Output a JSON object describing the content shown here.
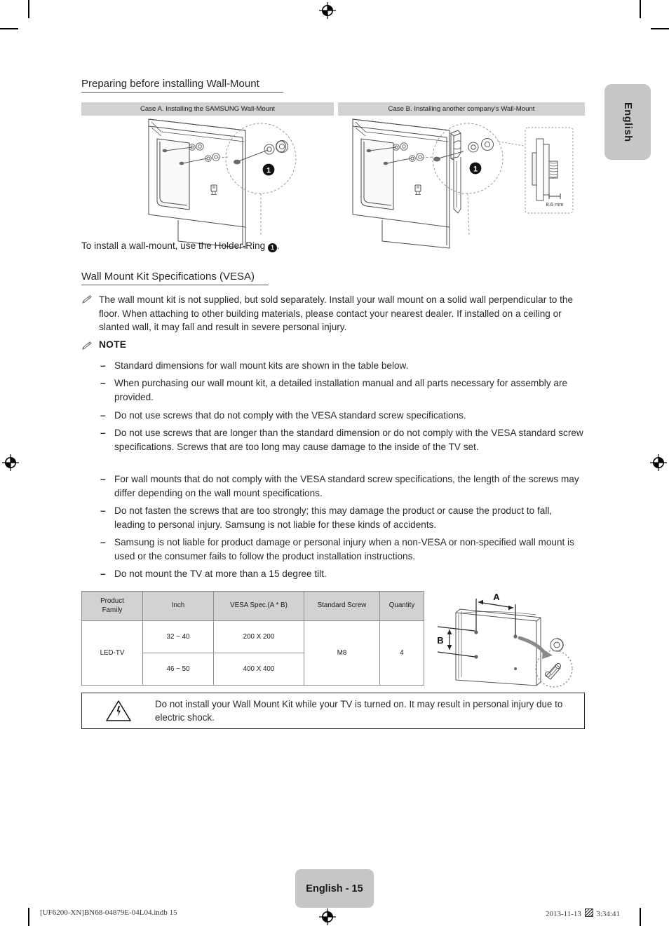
{
  "document": {
    "language_tab": "English",
    "page_badge": "English - 15",
    "footer_left": "[UF6200-XN]BN68-04879E-04L04.indb   15",
    "footer_right_date": "2013-11-13",
    "footer_right_time": "3:34:41"
  },
  "section1": {
    "heading": "Preparing before installing Wall-Mount",
    "case_a": "Case A. Installing the SAMSUNG Wall-Mount",
    "case_b": "Case B. Installing another company's Wall-Mount",
    "callout_number": "1",
    "detail_dimension": "8.6 mm",
    "instruction_before": "To install a wall-mount, use the Holder-Ring ",
    "instruction_after": "."
  },
  "section2": {
    "heading": "Wall Mount Kit Specifications (VESA)",
    "intro": "The wall mount kit is not supplied, but sold separately. Install your wall mount on a solid wall perpendicular to the floor. When attaching to other building materials, please contact your nearest dealer. If installed on a ceiling or slanted wall, it may fall and result in severe personal injury.",
    "note_label": "NOTE",
    "notes": [
      "Standard dimensions for wall mount kits are shown in the table below.",
      "When purchasing our wall mount kit, a detailed installation manual and all parts necessary for assembly are provided.",
      "Do not use screws that do not comply with the VESA standard screw specifications.",
      "Do not use screws that are longer than the standard dimension or do not comply with the VESA standard screw specifications. Screws that are too long may cause damage to the inside of the TV set.",
      "For wall mounts that do not comply with the VESA standard screw specifications, the length of the screws may differ depending on the wall mount specifications.",
      "Do not fasten the screws that are too strongly; this may damage the product or cause the product to fall, leading to personal injury. Samsung is not liable for these kinds of accidents.",
      "Samsung is not liable for product damage or personal injury when a non-VESA or non-specified wall mount is used or the consumer fails to follow the product installation instructions.",
      "Do not mount the TV at more than a 15 degree tilt."
    ]
  },
  "spec_table": {
    "headers": [
      "Product\nFamily",
      "Inch",
      "VESA Spec.(A * B)",
      "Standard Screw",
      "Quantity"
    ],
    "header_product_family_l1": "Product",
    "header_product_family_l2": "Family",
    "header_inch": "Inch",
    "header_vesa": "VESA Spec.(A * B)",
    "header_screw": "Standard Screw",
    "header_quantity": "Quantity",
    "product_family": "LED-TV",
    "rows": [
      {
        "inch": "32 ~ 40",
        "vesa": "200 X 200"
      },
      {
        "inch": "46 ~ 50",
        "vesa": "400 X 400"
      }
    ],
    "standard_screw": "M8",
    "quantity": "4",
    "diagram_label_a": "A",
    "diagram_label_b": "B"
  },
  "caution": {
    "icon": "warning-electric-shock-icon",
    "text": "Do not install your Wall Mount Kit while your TV is turned on. It may result in personal injury due to electric shock."
  }
}
